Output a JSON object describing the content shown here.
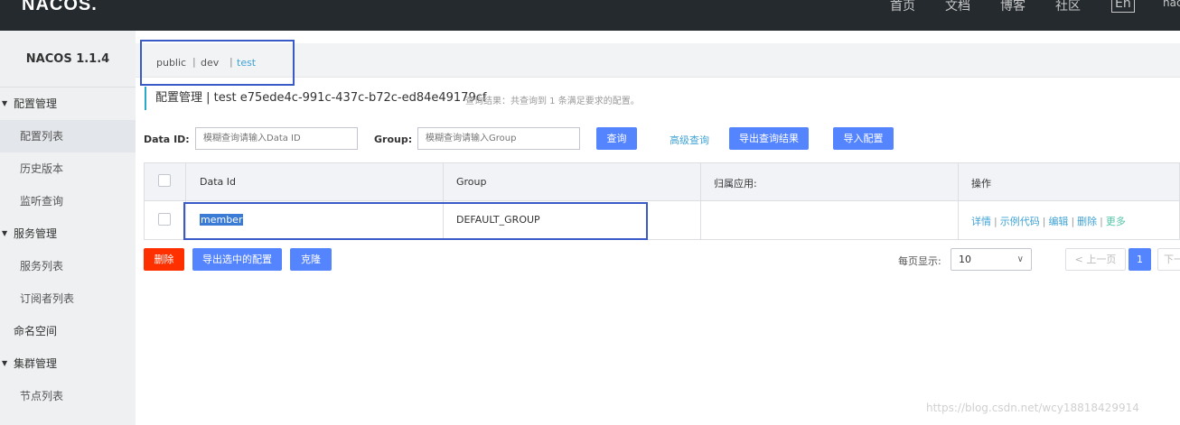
{
  "topbar": {
    "logo": "NACOS.",
    "nav": [
      "首页",
      "文档",
      "博客",
      "社区",
      "En",
      "nac"
    ]
  },
  "sidebar": {
    "title": "NACOS 1.1.4",
    "items": [
      {
        "label": "配置管理"
      },
      {
        "label": "配置列表"
      },
      {
        "label": "历史版本"
      },
      {
        "label": "监听查询"
      },
      {
        "label": "服务管理"
      },
      {
        "label": "服务列表"
      },
      {
        "label": "订阅者列表"
      },
      {
        "label": "命名空间"
      },
      {
        "label": "集群管理"
      },
      {
        "label": "节点列表"
      }
    ]
  },
  "namespaces": {
    "items": [
      "public",
      "dev",
      "test"
    ],
    "separator": "|",
    "active": "test"
  },
  "header": {
    "title": "配置管理  |  test  e75ede4c-991c-437c-b72c-ed84e49179cf",
    "hint": "查询结果：共查询到 1 条满足要求的配置。"
  },
  "filters": {
    "data_id_label": "Data ID:",
    "data_id_placeholder": "模糊查询请输入Data ID",
    "group_label": "Group:",
    "group_placeholder": "模糊查询请输入Group",
    "search_button": "查询",
    "advanced_link": "高级查询",
    "export_button": "导出查询结果",
    "import_button": "导入配置"
  },
  "table": {
    "columns": [
      "Data Id",
      "Group",
      "归属应用:",
      "操作"
    ],
    "rows": [
      {
        "data_id": "member",
        "group": "DEFAULT_GROUP",
        "app": ""
      }
    ],
    "ops": [
      "详情",
      "示例代码",
      "编辑",
      "删除",
      "更多"
    ],
    "ops_separator": "|"
  },
  "actions": {
    "delete": "删除",
    "export_selected": "导出选中的配置",
    "clone": "克隆"
  },
  "pagination": {
    "label": "每页显示:",
    "page_size": "10",
    "prev": "< 上一页",
    "current": "1",
    "next": "下一"
  },
  "watermark": "https://blog.csdn.net/wcy18818429914",
  "colors": {
    "topbar": "#252a2f",
    "primary": "#5584ff",
    "danger": "#ff3000",
    "link": "#3fa3d6",
    "highlight_box": "#3a5ac8"
  }
}
